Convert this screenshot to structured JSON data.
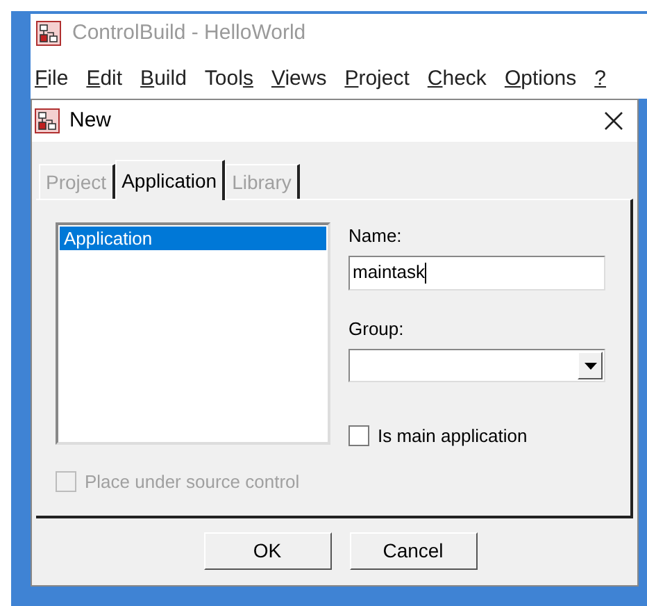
{
  "main_window": {
    "title": "ControlBuild - HelloWorld"
  },
  "menu": [
    {
      "mnemonic": "F",
      "after": "ile"
    },
    {
      "mnemonic": "E",
      "after": "dit"
    },
    {
      "mnemonic": "B",
      "after": "uild"
    },
    {
      "before": "Tool",
      "mnemonic": "s"
    },
    {
      "mnemonic": "V",
      "after": "iews"
    },
    {
      "mnemonic": "P",
      "after": "roject"
    },
    {
      "mnemonic": "C",
      "after": "heck"
    },
    {
      "mnemonic": "O",
      "after": "ptions"
    },
    {
      "mnemonic": "?"
    }
  ],
  "dialog": {
    "title": "New",
    "tabs": [
      {
        "label": "Project",
        "selected": false,
        "disabled": true
      },
      {
        "label": "Application",
        "selected": true,
        "disabled": false
      },
      {
        "label": "Library",
        "selected": false,
        "disabled": true
      }
    ],
    "list": [
      {
        "label": "Application",
        "selected": true
      }
    ],
    "name": {
      "label": "Name:",
      "value": "maintask"
    },
    "group": {
      "label": "Group:"
    },
    "is_main": {
      "label": "Is main application",
      "checked": false,
      "disabled": false
    },
    "source_control": {
      "label": "Place under source control",
      "checked": false,
      "disabled": true
    },
    "buttons": [
      "OK",
      "Cancel"
    ]
  }
}
